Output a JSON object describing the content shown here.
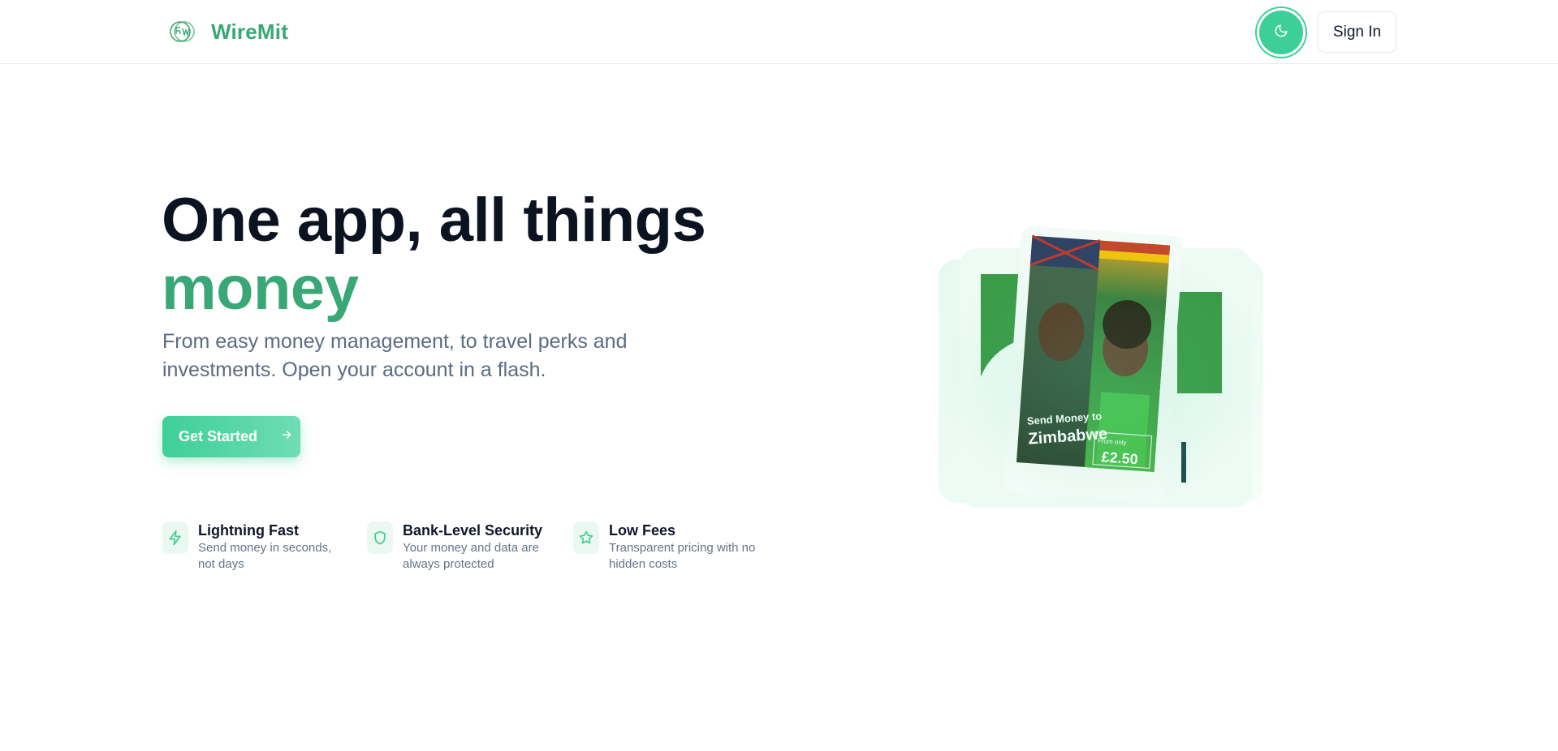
{
  "header": {
    "brand": "WireMit",
    "sign_in_label": "Sign In",
    "theme_toggle_icon": "moon-icon"
  },
  "hero": {
    "headline_line1": "One app, all things",
    "headline_accent": "money",
    "subtitle": "From easy money management, to travel perks and investments. Open your account in a flash.",
    "cta_label": "Get Started",
    "cta_icon": "arrow-right-icon"
  },
  "features": [
    {
      "icon": "lightning-icon",
      "title": "Lightning Fast",
      "description": "Send money in seconds, not days"
    },
    {
      "icon": "shield-icon",
      "title": "Bank-Level Security",
      "description": "Your money and data are always protected"
    },
    {
      "icon": "star-icon",
      "title": "Low Fees",
      "description": "Transparent pricing with no hidden costs"
    }
  ],
  "illustration": {
    "banner_line1": "Send Money to",
    "banner_line2": "Zimbabwe",
    "banner_fee_label": "From only",
    "banner_fee": "£2.50"
  },
  "colors": {
    "brand_green": "#3aa876",
    "accent_mint": "#3ecf98",
    "heading": "#0b1220",
    "muted": "#64748b"
  }
}
